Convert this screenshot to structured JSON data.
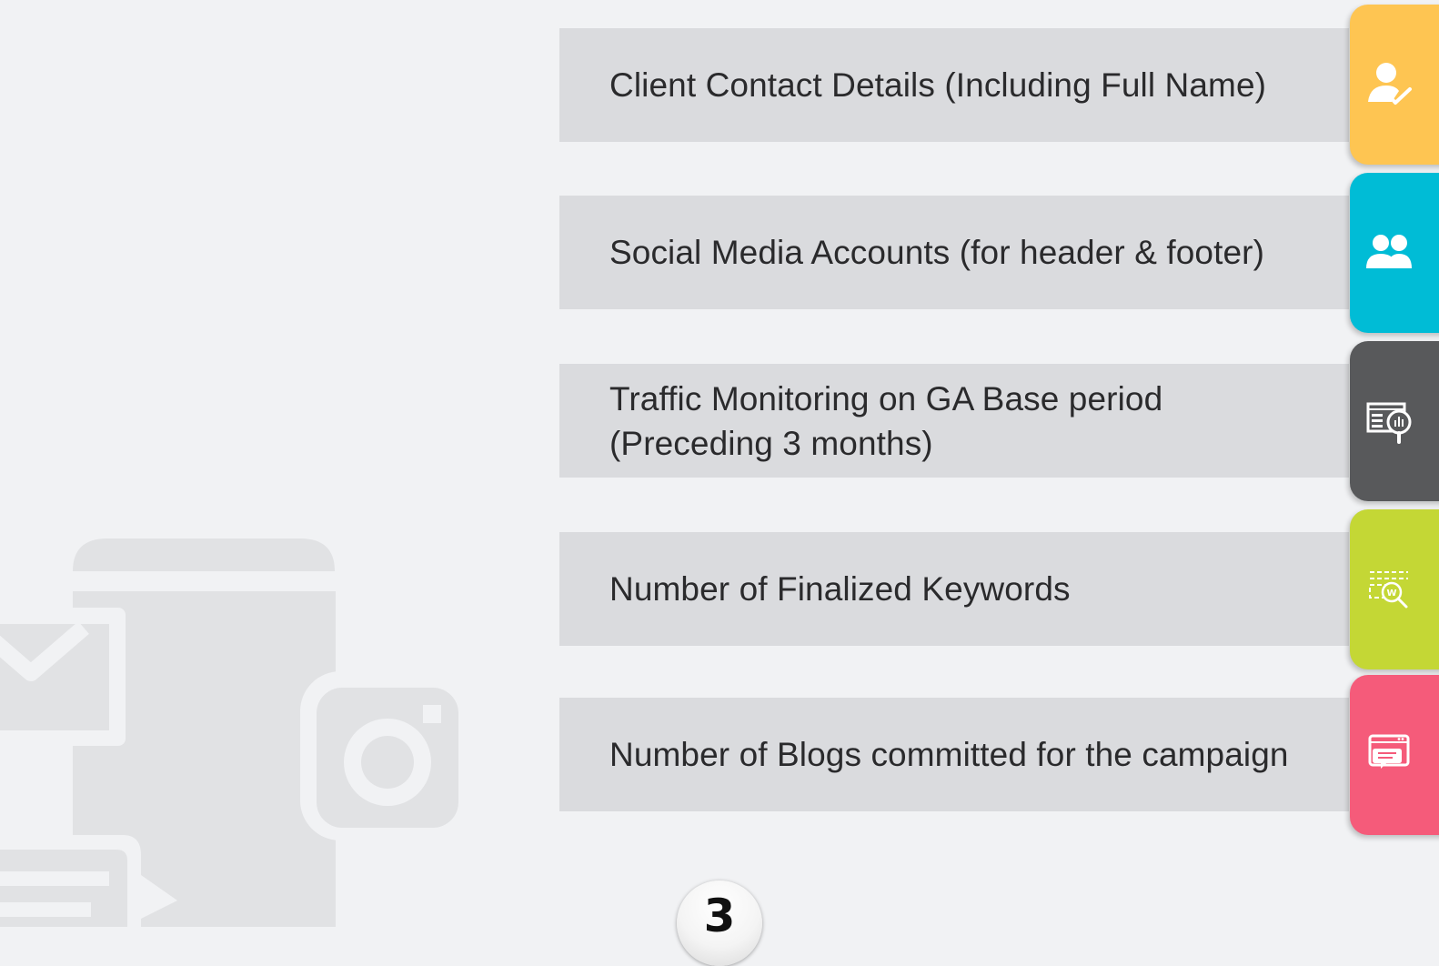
{
  "items": [
    {
      "text": "Client Contact Details (Including Full Name)",
      "color": "#fec552",
      "icon": "user-check-icon"
    },
    {
      "text": "Social Media Accounts (for header & footer)",
      "color": "#00bcd6",
      "icon": "users-icon"
    },
    {
      "text": "Traffic Monitoring on GA Base period\n(Preceding 3 months)",
      "color": "#58595b",
      "icon": "analytics-search-icon"
    },
    {
      "text": "Number of Finalized Keywords",
      "color": "#c4d735",
      "icon": "keyword-search-icon"
    },
    {
      "text": "Number of Blogs committed for the campaign",
      "color": "#f55b7a",
      "icon": "blog-chat-icon"
    }
  ],
  "page": {
    "number": "3"
  },
  "background_icons": [
    "phone-icon",
    "mail-icon",
    "instagram-icon",
    "chat-bubble-icon"
  ]
}
